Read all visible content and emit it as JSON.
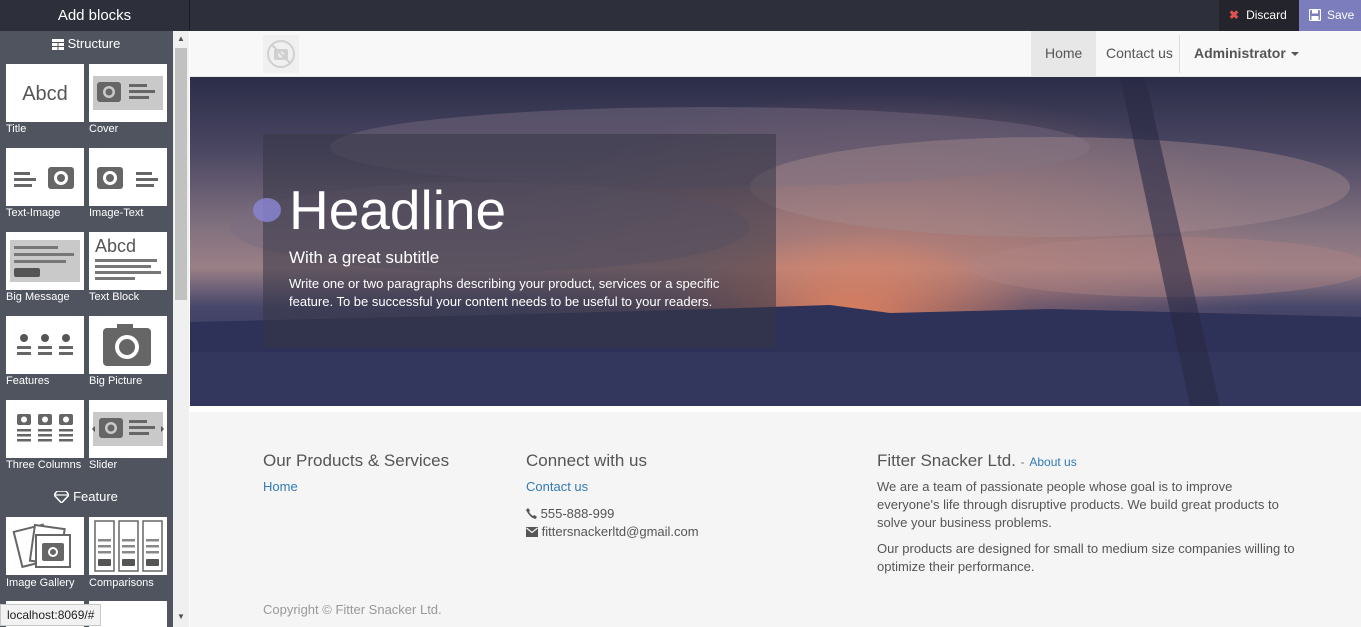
{
  "topbar": {
    "title": "Add blocks",
    "discard_label": "Discard",
    "save_label": "Save"
  },
  "sidebar": {
    "structure_title": "Structure",
    "feature_title": "Feature",
    "blocks": [
      {
        "label": "Title",
        "icon": "title-abcd-thumbnail"
      },
      {
        "label": "Cover",
        "icon": "cover-thumbnail"
      },
      {
        "label": "Text-Image",
        "icon": "text-image-thumbnail"
      },
      {
        "label": "Image-Text",
        "icon": "image-text-thumbnail"
      },
      {
        "label": "Big Message",
        "icon": "big-message-thumbnail"
      },
      {
        "label": "Text Block",
        "icon": "text-block-thumbnail"
      },
      {
        "label": "Features",
        "icon": "features-thumbnail"
      },
      {
        "label": "Big Picture",
        "icon": "big-picture-thumbnail"
      },
      {
        "label": "Three Columns",
        "icon": "three-columns-thumbnail"
      },
      {
        "label": "Slider",
        "icon": "slider-thumbnail"
      }
    ],
    "feature_blocks": [
      {
        "label": "Image Gallery",
        "icon": "image-gallery-thumbnail"
      },
      {
        "label": "Comparisons",
        "icon": "comparisons-thumbnail"
      }
    ],
    "abcd_text": "Abcd"
  },
  "status_url": "localhost:8069/#",
  "navbar": {
    "items": [
      {
        "label": "Home",
        "active": true
      },
      {
        "label": "Contact us",
        "active": false
      }
    ],
    "user_menu": "Administrator"
  },
  "hero": {
    "headline": "Headline",
    "subtitle": "With a great subtitle",
    "description": "Write one or two paragraphs describing your product, services or a specific feature. To be successful your content needs to be useful to your readers."
  },
  "footer": {
    "products_title": "Our Products & Services",
    "products_link": "Home",
    "connect_title": "Connect with us",
    "connect_link": "Contact us",
    "phone": "555-888-999",
    "email": "fittersnackerltd@gmail.com",
    "company_name": "Fitter Snacker Ltd.",
    "about_sep": "-",
    "about_link": "About us",
    "about_text_1": "We are a team of passionate people whose goal is to improve everyone's life through disruptive products. We build great products to solve your business problems.",
    "about_text_2": "Our products are designed for small to medium size companies willing to optimize their performance.",
    "copyright": "Copyright © Fitter Snacker Ltd."
  },
  "colors": {
    "topbar_bg": "#2d2f3a",
    "save_bg": "#7b7dbd",
    "discard_icon": "#e05252",
    "sidebar_bg": "#4f545f",
    "link": "#337ab7"
  }
}
